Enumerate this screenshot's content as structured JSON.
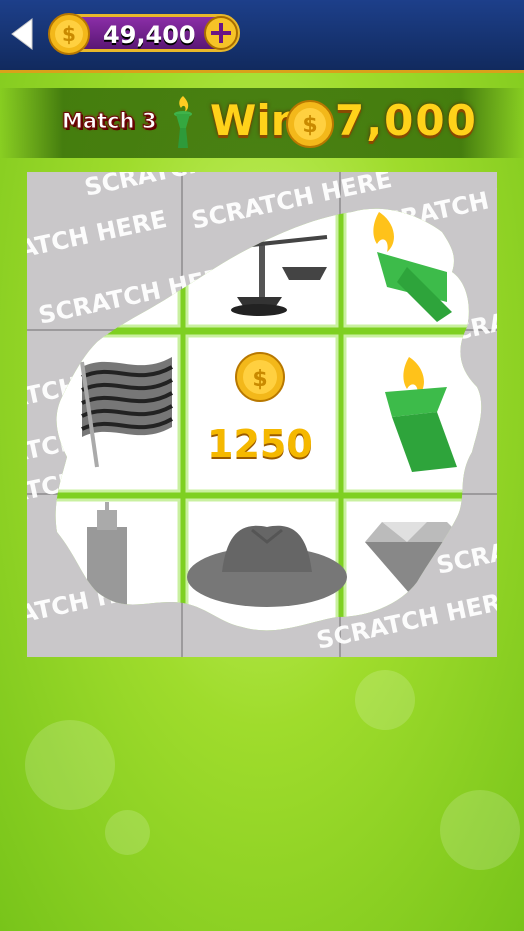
{
  "header": {
    "coin_balance": "49,400"
  },
  "banner": {
    "match_label": "Match 3",
    "win_label": "Win",
    "win_amount": "7,000"
  },
  "card": {
    "scratch_label": "SCRATCH HERE",
    "prize_value": "1250",
    "revealed_symbols": [
      "scale",
      "torch",
      "flag",
      "coin",
      "torch",
      "building",
      "cowboy-hat",
      "diamond"
    ]
  },
  "colors": {
    "topbar": "#1d3f8a",
    "accent_gold": "#ffd21a",
    "purple_pill": "#8b2ea8",
    "background_green": "#9fdc2c",
    "cell_border": "#7ed021"
  }
}
